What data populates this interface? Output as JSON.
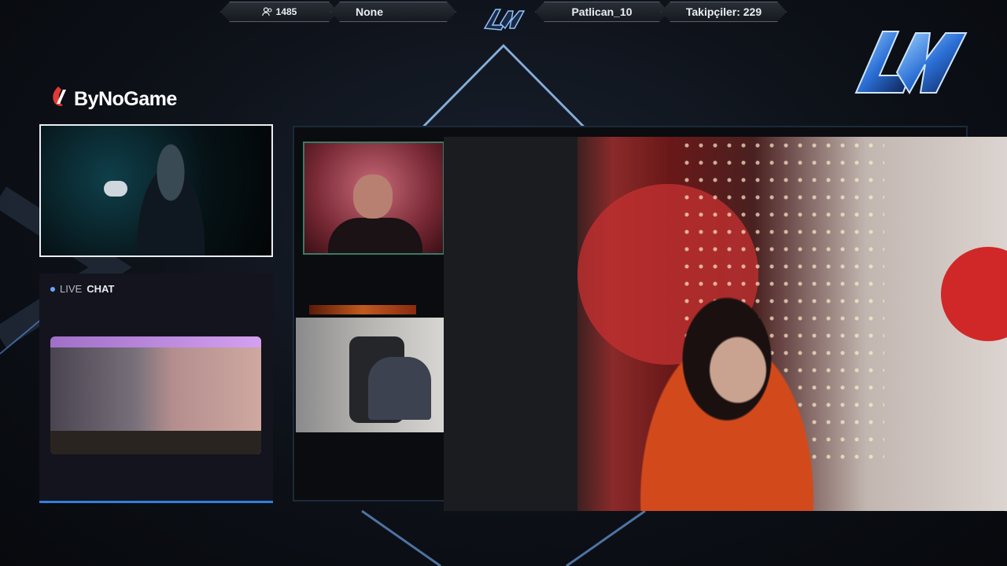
{
  "topbar": {
    "viewers": "1485",
    "game": "None",
    "username": "Patlican_10",
    "followers_label": "Takipçiler: 229"
  },
  "sponsor": {
    "name": "ByNoGame"
  },
  "chat": {
    "live_label": "LIVE",
    "chat_label": "CHAT"
  },
  "colors": {
    "accent": "#2f7fdd",
    "sponsor_red": "#e53935",
    "frame_green": "#3a7a66"
  },
  "icons": {
    "viewers": "users-icon",
    "sponsor": "bynogame-logo-icon",
    "brand": "lnv-logo-icon"
  }
}
